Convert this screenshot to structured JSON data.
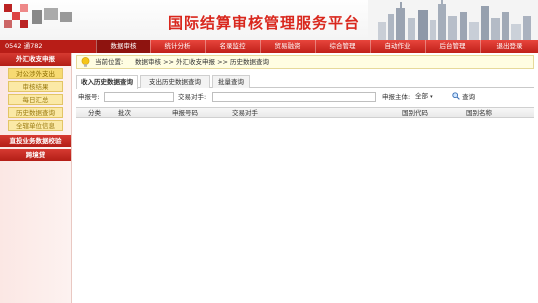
{
  "header": {
    "title": "国际结算审核管理服务平台"
  },
  "user": {
    "info": "0542 通782"
  },
  "nav": {
    "items": [
      {
        "label": "数据审核",
        "active": true
      },
      {
        "label": "统计分析",
        "active": false
      },
      {
        "label": "名录监控",
        "active": false
      },
      {
        "label": "贸易融资",
        "active": false
      },
      {
        "label": "综合管理",
        "active": false
      },
      {
        "label": "自动作业",
        "active": false
      },
      {
        "label": "后台管理",
        "active": false
      },
      {
        "label": "退出登录",
        "active": false
      }
    ]
  },
  "sidebar": {
    "section_title": "外汇收支申报",
    "items": [
      {
        "label": "对公涉外支出"
      },
      {
        "label": "审核结果"
      },
      {
        "label": "每日汇总"
      },
      {
        "label": "历史数据查询"
      },
      {
        "label": "全辖单位信息"
      }
    ],
    "sub_sections": [
      {
        "label": "直投业务数据校验"
      },
      {
        "label": "跨境贷"
      }
    ]
  },
  "breadcrumb": {
    "label": "当前位置:",
    "path": "数据审核 >> 外汇收支申报 >> 历史数据查询"
  },
  "tabs": [
    {
      "label": "收入历史数据查询",
      "active": true
    },
    {
      "label": "支出历史数据查询",
      "active": false
    },
    {
      "label": "批量查询",
      "active": false
    }
  ],
  "filters": {
    "report_no_label": "申报号:",
    "counterparty_label": "交易对手:",
    "subject_label": "申报主体:",
    "subject_value": "全部",
    "search_label": "查询"
  },
  "table": {
    "columns": [
      "分类",
      "批次",
      "申报号码",
      "交易对手",
      "国别代码",
      "国别名称"
    ]
  },
  "colors": {
    "brand_red": "#d9271d",
    "nav_red": "#c0201a",
    "sidebar_item_bg": "#fbe9a6"
  }
}
